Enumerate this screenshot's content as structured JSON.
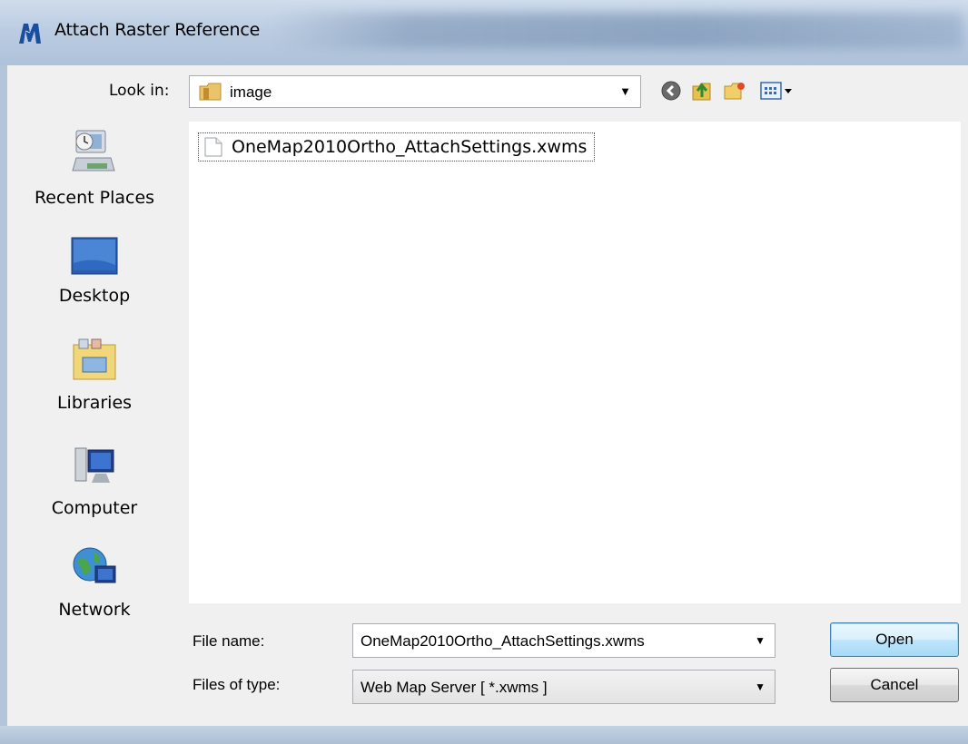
{
  "window": {
    "title": "Attach Raster Reference"
  },
  "toolbar": {
    "look_in_label": "Look in:",
    "look_in_value": "image",
    "buttons": [
      "back-icon",
      "up-folder-icon",
      "new-folder-icon",
      "view-menu-icon"
    ]
  },
  "places": {
    "items": [
      {
        "label": "Recent Places",
        "icon": "recent-places-icon"
      },
      {
        "label": "Desktop",
        "icon": "desktop-icon"
      },
      {
        "label": "Libraries",
        "icon": "libraries-icon"
      },
      {
        "label": "Computer",
        "icon": "computer-icon"
      },
      {
        "label": "Network",
        "icon": "network-icon"
      }
    ]
  },
  "files": [
    {
      "name": "OneMap2010Ortho_AttachSettings.xwms",
      "selected": true
    }
  ],
  "form": {
    "file_name_label": "File name:",
    "file_name_value": "OneMap2010Ortho_AttachSettings.xwms",
    "file_type_label": "Files of type:",
    "file_type_value": "Web Map Server [ *.xwms ]"
  },
  "buttons": {
    "open": "Open",
    "cancel": "Cancel"
  },
  "colors": {
    "accent": "#3c7fb1",
    "dialog_bg": "#f0f0f0"
  }
}
